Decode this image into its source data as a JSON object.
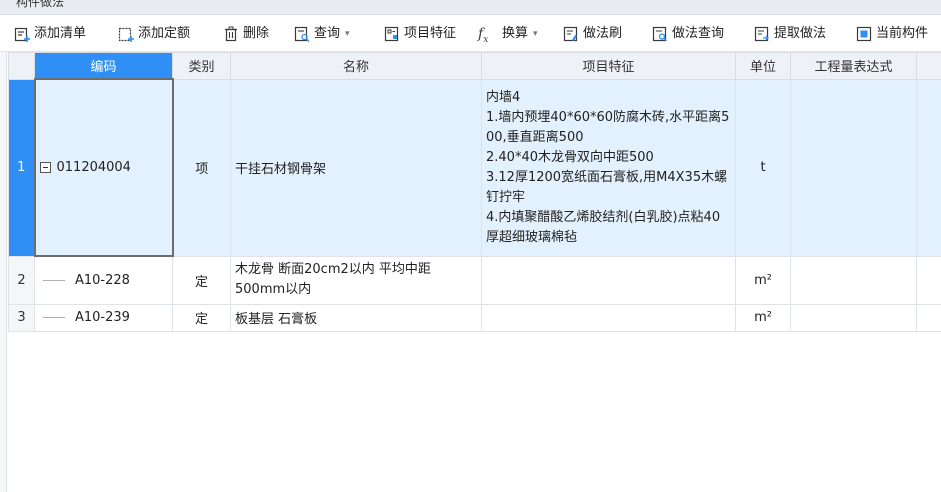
{
  "panel": {
    "title": "构件做法"
  },
  "toolbar": {
    "items": [
      {
        "label": "添加清单",
        "icon": "add-list-icon"
      },
      {
        "label": "添加定额",
        "icon": "add-quota-icon"
      },
      {
        "label": "删除",
        "icon": "trash-icon"
      },
      {
        "label": "查询",
        "icon": "query-icon",
        "dropdown": true
      },
      {
        "label": "项目特征",
        "icon": "feature-icon"
      },
      {
        "label": "换算",
        "icon": "fx-icon",
        "dropdown": true
      },
      {
        "label": "做法刷",
        "icon": "brush-icon"
      },
      {
        "label": "做法查询",
        "icon": "method-query-icon"
      },
      {
        "label": "提取做法",
        "icon": "extract-icon"
      },
      {
        "label": "当前构件",
        "icon": "current-component-icon"
      }
    ],
    "dropdown_glyph": "▾"
  },
  "table": {
    "headers": {
      "code": "编码",
      "category": "类别",
      "name": "名称",
      "feature": "项目特征",
      "unit": "单位",
      "expression": "工程量表达式"
    },
    "rows": [
      {
        "num": "1",
        "code": "011204004",
        "category": "项",
        "name": "干挂石材钢骨架",
        "feature": "内墙4\n1.墙内预埋40*60*60防腐木砖,水平距离500,垂直距离500\n2.40*40木龙骨双向中距500\n3.12厚1200宽纸面石膏板,用M4X35木螺钉拧牢\n4.内填聚醋酸乙烯胶结剂(白乳胶)点粘40厚超细玻璃棉毡",
        "unit": "t",
        "expression": ""
      },
      {
        "num": "2",
        "code": "A10-228",
        "category": "定",
        "name": "木龙骨 断面20cm2以内 平均中距500mm以内",
        "feature": "",
        "unit": "m²",
        "expression": ""
      },
      {
        "num": "3",
        "code": "A10-239",
        "category": "定",
        "name": "板基层 石膏板",
        "feature": "",
        "unit": "m²",
        "expression": ""
      }
    ]
  },
  "colors": {
    "accent": "#2f8ff5",
    "selected_row": "#e3f0fd",
    "header_bg": "#eef1f5"
  }
}
